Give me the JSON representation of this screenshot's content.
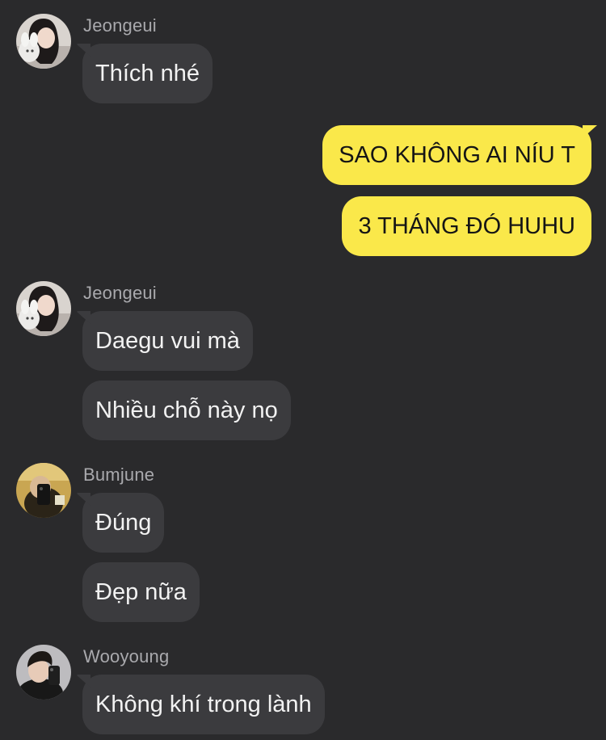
{
  "messages": [
    {
      "sender": "Jeongeui",
      "texts": [
        "Thích nhé"
      ]
    },
    {
      "sender": "me",
      "texts": [
        "SAO KHÔNG AI NÍU T",
        "3 THÁNG ĐÓ HUHU"
      ]
    },
    {
      "sender": "Jeongeui",
      "texts": [
        "Daegu vui mà",
        "Nhiều chỗ này nọ"
      ]
    },
    {
      "sender": "Bumjune",
      "texts": [
        "Đúng",
        "Đẹp nữa"
      ]
    },
    {
      "sender": "Wooyoung",
      "texts": [
        "Không khí trong lành"
      ]
    }
  ],
  "theme": {
    "background": "#2a2a2c",
    "incoming_bubble": "#3b3b3e",
    "outgoing_bubble": "#fae84a",
    "sender_name": "#a9a9ad"
  }
}
